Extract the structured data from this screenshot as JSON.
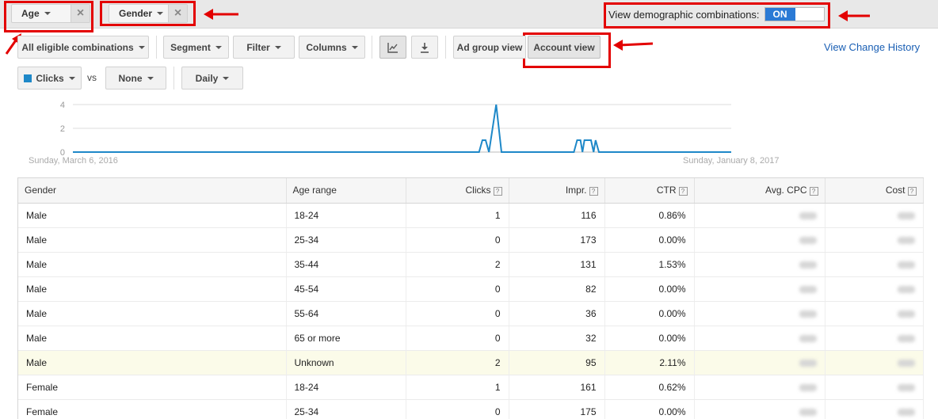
{
  "filters": {
    "age_label": "Age",
    "gender_label": "Gender",
    "demo_label": "View demographic combinations:",
    "demo_state": "ON"
  },
  "toolbar": {
    "combinations": "All eligible combinations",
    "segment": "Segment",
    "filter": "Filter",
    "columns": "Columns",
    "ad_group_view": "Ad group view",
    "account_view": "Account view",
    "change_history": "View Change History"
  },
  "metrics": {
    "primary": "Clicks",
    "vs": "vs",
    "secondary": "None",
    "period": "Daily"
  },
  "chart_data": {
    "type": "line",
    "x_start_label": "Sunday, March 6, 2016",
    "x_end_label": "Sunday, January 8, 2017",
    "y_ticks": [
      "4",
      "2",
      "0"
    ],
    "ylim": [
      0,
      4
    ],
    "series": [
      {
        "name": "Clicks",
        "color": "#1e88c8",
        "points": [
          [
            0,
            0
          ],
          [
            0.617,
            0
          ],
          [
            0.622,
            1
          ],
          [
            0.627,
            1
          ],
          [
            0.632,
            0
          ],
          [
            0.643,
            4
          ],
          [
            0.651,
            0
          ],
          [
            0.761,
            0
          ],
          [
            0.766,
            1
          ],
          [
            0.771,
            1
          ],
          [
            0.774,
            0
          ],
          [
            0.777,
            1
          ],
          [
            0.782,
            1
          ],
          [
            0.787,
            1
          ],
          [
            0.791,
            0
          ],
          [
            0.794,
            1
          ],
          [
            0.799,
            0
          ],
          [
            1,
            0
          ]
        ]
      }
    ]
  },
  "table": {
    "headers": [
      "Gender",
      "Age range",
      "Clicks",
      "Impr.",
      "CTR",
      "Avg. CPC",
      "Cost"
    ],
    "rows": [
      [
        "Male",
        "18-24",
        "1",
        "116",
        "0.86%"
      ],
      [
        "Male",
        "25-34",
        "0",
        "173",
        "0.00%"
      ],
      [
        "Male",
        "35-44",
        "2",
        "131",
        "1.53%"
      ],
      [
        "Male",
        "45-54",
        "0",
        "82",
        "0.00%"
      ],
      [
        "Male",
        "55-64",
        "0",
        "36",
        "0.00%"
      ],
      [
        "Male",
        "65 or more",
        "0",
        "32",
        "0.00%"
      ],
      [
        "Male",
        "Unknown",
        "2",
        "95",
        "2.11%"
      ],
      [
        "Female",
        "18-24",
        "1",
        "161",
        "0.62%"
      ],
      [
        "Female",
        "25-34",
        "0",
        "175",
        "0.00%"
      ]
    ]
  },
  "colors": {
    "highlight": "#e30000",
    "toggle_on": "#2a7ad5",
    "series": "#1e88c8"
  }
}
